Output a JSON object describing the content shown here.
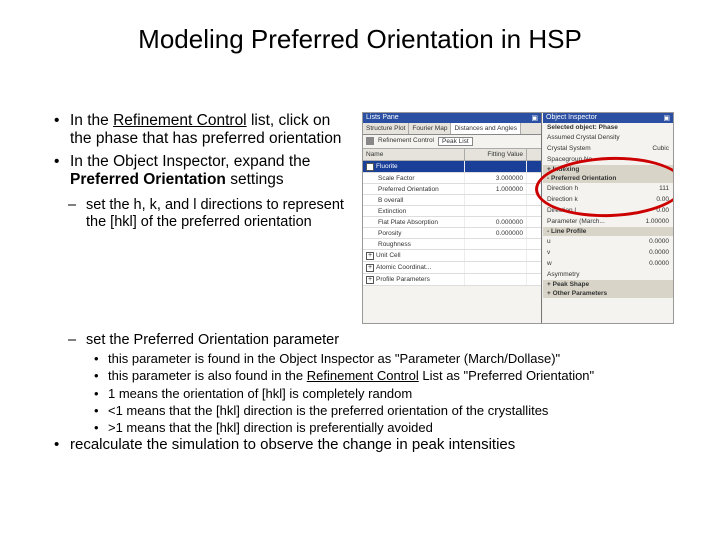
{
  "title": "Modeling Preferred Orientation in HSP",
  "bullets": {
    "b1a_pre": "In the ",
    "b1a_u": "Refinement Control",
    "b1a_post": " list, click on the phase that has preferred orientation",
    "b1b_pre": "In the Object Inspector, expand the ",
    "b1b_b": "Preferred Orientation",
    "b1b_post": " settings",
    "b2a": "set the h, k, and l directions to represent the [hkl] of the preferred orientation",
    "b2b": "set the Preferred Orientation parameter",
    "b3a": "this parameter is found in the Object Inspector as \"Parameter (March/Dollase)\"",
    "b3b_pre": "this parameter is also found in the ",
    "b3b_u": "Refinement Control",
    "b3b_post": " List as \"Preferred Orientation\"",
    "b3c": "1 means the orientation of [hkl] is completely random",
    "b3d": "<1 means that the [hkl] direction is the preferred orientation of the crystallites",
    "b3e": ">1 means that the [hkl] direction is preferentially avoided",
    "closing": "recalculate the simulation to observe the change in peak intensities"
  },
  "shot": {
    "left_title": "Lists Pane",
    "right_title": "Object Inspector",
    "tabs": [
      "Structure Plot",
      "Fourier Map",
      "Distances and Angles"
    ],
    "subbar": {
      "label": "Refinement Control",
      "btn": "Peak List"
    },
    "grid_head": {
      "c1": "Name",
      "c2": "Fitting Value"
    },
    "rows": [
      {
        "name": "Fluorite",
        "val": "",
        "selected": true,
        "exp": "-"
      },
      {
        "name": "Scale Factor",
        "val": "3.000000",
        "exp": ""
      },
      {
        "name": "Preferred Orientation",
        "val": "1.000000",
        "exp": ""
      },
      {
        "name": "B overall",
        "val": "",
        "exp": ""
      },
      {
        "name": "Extinction",
        "val": "",
        "exp": ""
      },
      {
        "name": "Flat Plate Absorption",
        "val": "0.000000",
        "exp": ""
      },
      {
        "name": "Porosity",
        "val": "0.000000",
        "exp": ""
      },
      {
        "name": "Roughness",
        "val": "",
        "exp": ""
      },
      {
        "name": "Unit Cell",
        "val": "",
        "exp": "+"
      },
      {
        "name": "Atomic Coordinat...",
        "val": "",
        "exp": "+"
      },
      {
        "name": "Profile Parameters",
        "val": "",
        "exp": "+"
      }
    ],
    "right": {
      "selected_label": "Selected object: Phase",
      "fields1": [
        {
          "k": "Assumed Crystal Density",
          "v": ""
        },
        {
          "k": "Crystal System",
          "v": "Cubic"
        },
        {
          "k": "Spacegroup No.",
          "v": ""
        }
      ],
      "head1": "Indexing",
      "head2": "Preferred Orientation",
      "po_fields": [
        {
          "k": "Direction h",
          "v": "111"
        },
        {
          "k": "Direction k",
          "v": "0.00"
        },
        {
          "k": "Direction l",
          "v": "0.00"
        },
        {
          "k": "Parameter (March...",
          "v": "1.00000"
        }
      ],
      "head3": "Line Profile",
      "lp_fields": [
        {
          "k": "u",
          "v": "0.0000"
        },
        {
          "k": "v",
          "v": "0.0000"
        },
        {
          "k": "w",
          "v": "0.0000"
        },
        {
          "k": "Asymmetry",
          "v": ""
        }
      ],
      "head4a": "Peak Shape",
      "head4b": "Other Parameters"
    }
  }
}
